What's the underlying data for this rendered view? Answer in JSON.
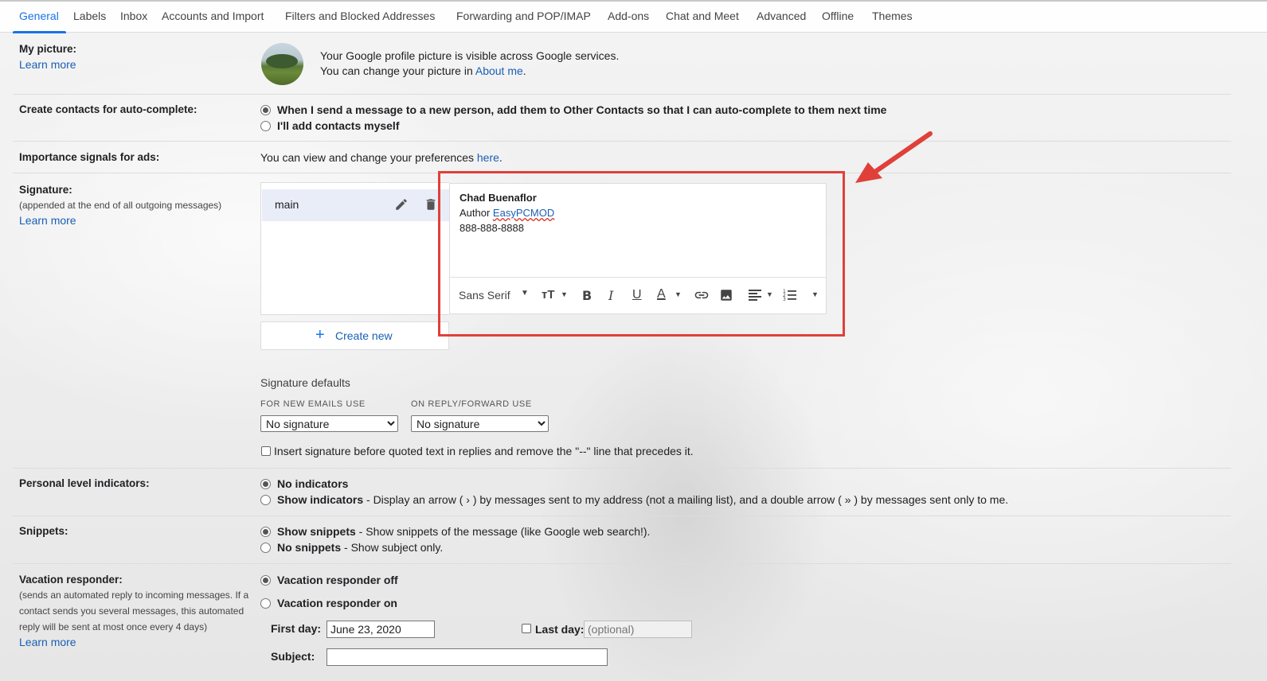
{
  "tabs": [
    "General",
    "Labels",
    "Inbox",
    "Accounts and Import",
    "Filters and Blocked Addresses",
    "Forwarding and POP/IMAP",
    "Add-ons",
    "Chat and Meet",
    "Advanced",
    "Offline",
    "Themes"
  ],
  "picture": {
    "label": "My picture:",
    "learn_more": "Learn more",
    "line1": "Your Google profile picture is visible across Google services.",
    "line2_prefix": "You can change your picture in ",
    "line2_link": "About me",
    "line2_suffix": "."
  },
  "contacts": {
    "label": "Create contacts for auto-complete:",
    "option1": "When I send a message to a new person, add them to Other Contacts so that I can auto-complete to them next time",
    "option2": "I'll add contacts myself"
  },
  "ads": {
    "label": "Importance signals for ads:",
    "text_prefix": "You can view and change your preferences ",
    "text_link": "here",
    "text_suffix": "."
  },
  "signature": {
    "label": "Signature:",
    "sublabel": "(appended at the end of all outgoing messages)",
    "learn_more": "Learn more",
    "item_name": "main",
    "create_new": "Create new",
    "editor": {
      "name": "Chad Buenaflor",
      "title_prefix": "Author ",
      "title_link": "EasyPCMOD",
      "phone": "888-888-8888"
    },
    "font": "Sans Serif",
    "defaults_title": "Signature defaults",
    "new_emails_label": "FOR NEW EMAILS USE",
    "reply_label": "ON REPLY/FORWARD USE",
    "new_emails_value": "No signature",
    "reply_value": "No signature",
    "insert_before": "Insert signature before quoted text in replies and remove the \"--\" line that precedes it."
  },
  "personal": {
    "label": "Personal level indicators:",
    "opt1": "No indicators",
    "opt2_bold": "Show indicators",
    "opt2_rest": " - Display an arrow ( › ) by messages sent to my address (not a mailing list), and a double arrow ( » ) by messages sent only to me."
  },
  "snippets": {
    "label": "Snippets:",
    "opt1_bold": "Show snippets",
    "opt1_rest": " - Show snippets of the message (like Google web search!).",
    "opt2_bold": "No snippets",
    "opt2_rest": " - Show subject only."
  },
  "vacation": {
    "label": "Vacation responder:",
    "sub1": "(sends an automated reply to incoming messages. If a",
    "sub2": "contact sends you several messages, this automated",
    "sub3": "reply will be sent at most once every 4 days)",
    "learn_more": "Learn more",
    "off": "Vacation responder off",
    "on": "Vacation responder on",
    "first_day_label": "First day:",
    "first_day_value": "June 23, 2020",
    "last_day_label": "Last day:",
    "last_day_placeholder": "(optional)",
    "subject_label": "Subject:"
  },
  "colors": {
    "accent": "#1a73e8",
    "highlight_box": "#e0403a"
  }
}
